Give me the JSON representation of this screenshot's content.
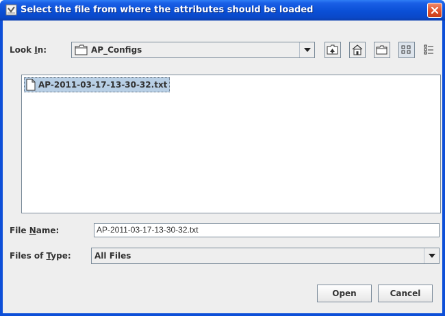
{
  "window": {
    "title": "Select the file from where the attributes should be loaded",
    "colors": {
      "titlebar": "#0a4fd6",
      "close": "#e0502a",
      "client": "#eeeeee",
      "selection": "#b8cfe5"
    }
  },
  "lookin": {
    "label_pre": "Look ",
    "label_mnemonic": "I",
    "label_post": "n:",
    "value": "AP_Configs",
    "folder_icon": "folder-icon"
  },
  "toolbar": {
    "buttons": [
      {
        "name": "up-one-level",
        "icon": "up-folder-icon"
      },
      {
        "name": "home",
        "icon": "home-icon"
      },
      {
        "name": "create-new-folder",
        "icon": "new-folder-icon"
      },
      {
        "name": "list-view",
        "icon": "list-view-icon",
        "pressed": true
      },
      {
        "name": "details-view",
        "icon": "details-view-icon"
      }
    ]
  },
  "files": [
    {
      "name": "AP-2011-03-17-13-30-32.txt",
      "icon": "file-icon",
      "selected": true
    }
  ],
  "filename": {
    "label_pre": "File ",
    "label_mnemonic": "N",
    "label_post": "ame:",
    "value": "AP-2011-03-17-13-30-32.txt"
  },
  "filetype": {
    "label_pre": "Files of ",
    "label_mnemonic": "T",
    "label_post": "ype:",
    "value": "All Files"
  },
  "actions": {
    "open_label": "Open",
    "cancel_label": "Cancel"
  }
}
